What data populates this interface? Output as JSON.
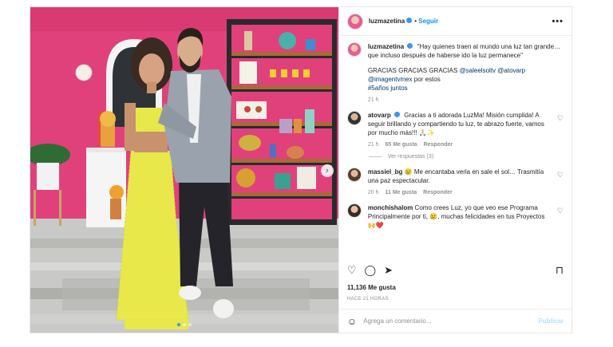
{
  "post": {
    "username": "luzmazetina",
    "follow_label": "Seguir",
    "more_label": "•••",
    "caption": {
      "username": "luzmazetina",
      "quote": "\"Hay quienes traen al mundo una luz tan grande… que incluso después de haberse ido la luz permanece\"",
      "thanks": "GRACIAS GRACIAS GRACIAS",
      "mention_1": "@saleelsoltv",
      "mention_2": "@atovarp",
      "mention_3": "@imagentvmex",
      "por_estos": "por estos",
      "hashtag": "#5años juntos",
      "time": "21 h"
    },
    "comments": [
      {
        "username": "atovarp",
        "text": "Gracias a ti adorada LuzMa! Misión cumplida! A seguir brillando y compartiendo tu luz, te abrazo fuerte, vamos por mucho más!!! 🙏🏻✨",
        "time": "21 h",
        "likes": "65 Me gusta",
        "reply": "Responder",
        "view_replies": "Ver respuestas (3)"
      },
      {
        "username": "massiel_bg",
        "text": "😢 Me encantaba verla en sale el sol… Trasmitía una paz espectacular.",
        "time": "20 h",
        "likes": "11 Me gusta",
        "reply": "Responder"
      },
      {
        "username": "monchishalom",
        "text": "Como crees Luz, yo que veo ese Programa Principalmente por ti, 😢, muchas felicidades en tus Proyectos 🙌❤️"
      }
    ],
    "likes_label": "11,136 Me gusta",
    "time_ago": "HACE 21 HORAS",
    "comment_placeholder": "Agrega un comentario...",
    "post_button": "Publicar"
  },
  "icons": {
    "heart": "♡",
    "comment": "◯",
    "share": "➤",
    "save": "⊓",
    "emoji": "☺",
    "next": "›"
  },
  "colors": {
    "accent": "#0095f6",
    "verified": "#3897f0",
    "backdrop_pink": "#e0417a",
    "dress_yellow": "#e8e84a"
  }
}
